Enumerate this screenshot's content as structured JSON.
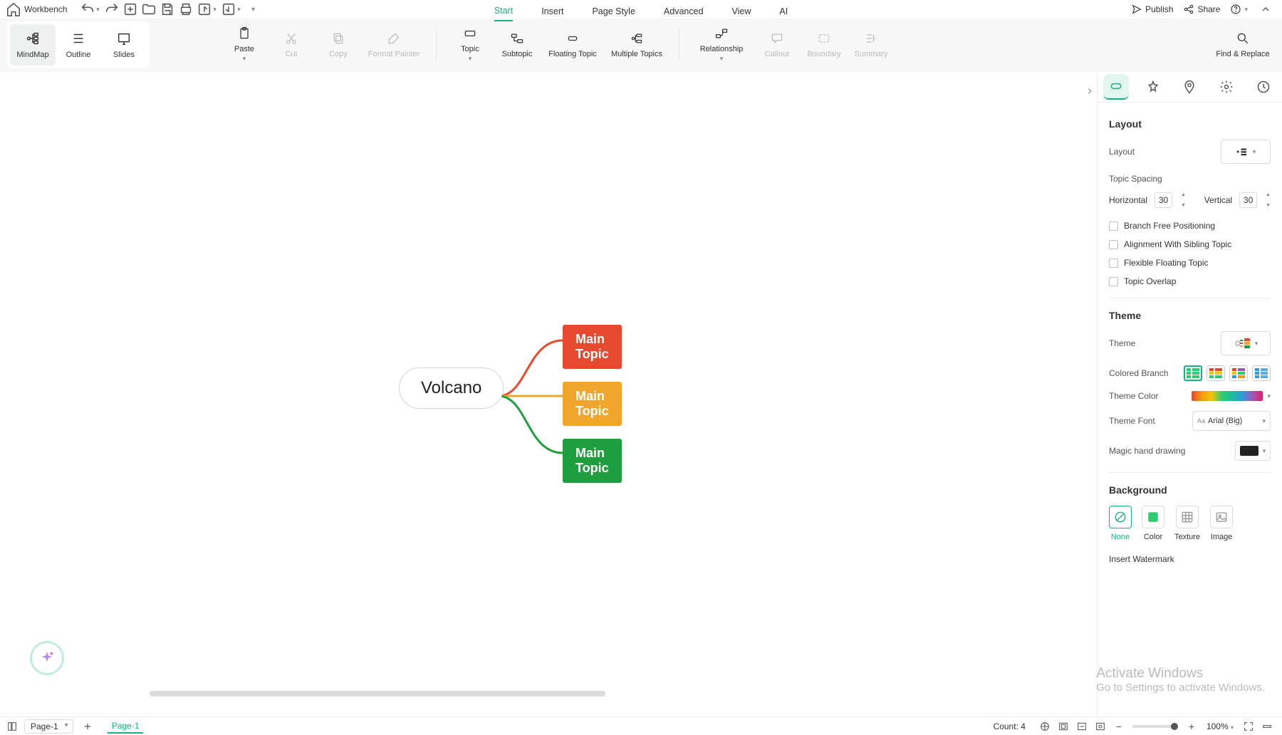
{
  "titlebar": {
    "doc_title": "Workbench"
  },
  "menutabs": {
    "start": "Start",
    "insert": "Insert",
    "page_style": "Page Style",
    "advanced": "Advanced",
    "view": "View",
    "ai": "AI"
  },
  "top_right": {
    "publish": "Publish",
    "share": "Share"
  },
  "view_switch": {
    "mindmap": "MindMap",
    "outline": "Outline",
    "slides": "Slides"
  },
  "ribbon": {
    "paste": "Paste",
    "cut": "Cut",
    "copy": "Copy",
    "format_painter": "Format Painter",
    "topic": "Topic",
    "subtopic": "Subtopic",
    "floating": "Floating Topic",
    "multiple": "Multiple Topics",
    "relationship": "Relationship",
    "callout": "Callout",
    "boundary": "Boundary",
    "summary": "Summary",
    "find_replace": "Find & Replace"
  },
  "mindmap": {
    "central": "Volcano",
    "b1": "Main Topic",
    "b2": "Main Topic",
    "b3": "Main Topic"
  },
  "panel": {
    "layout_title": "Layout",
    "layout_label": "Layout",
    "topic_spacing": "Topic Spacing",
    "horizontal": "Horizontal",
    "h_val": "30",
    "vertical": "Vertical",
    "v_val": "30",
    "branch_free": "Branch Free Positioning",
    "align_sibling": "Alignment With Sibling Topic",
    "flexible_floating": "Flexible Floating Topic",
    "topic_overlap": "Topic Overlap",
    "theme_title": "Theme",
    "theme_label": "Theme",
    "colored_branch": "Colored Branch",
    "theme_color": "Theme Color",
    "theme_font": "Theme Font",
    "theme_font_val": "Arial (Big)",
    "magic_hand": "Magic hand drawing",
    "background_title": "Background",
    "bg_none": "None",
    "bg_color": "Color",
    "bg_texture": "Texture",
    "bg_image": "Image",
    "insert_watermark": "Insert Watermark"
  },
  "win_wm": {
    "l1": "Activate Windows",
    "l2": "Go to Settings to activate Windows."
  },
  "pagebar": {
    "page_dd": "Page-1",
    "page_tab": "Page-1",
    "count_label": "Count:",
    "count_val": "4",
    "zoom": "100%"
  }
}
